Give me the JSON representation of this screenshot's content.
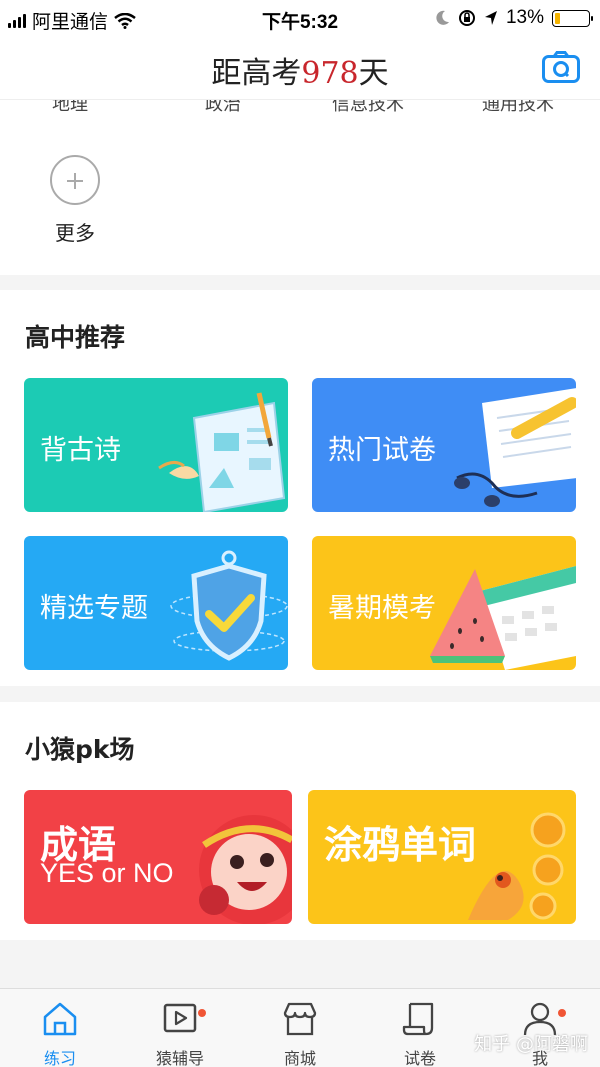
{
  "status_bar": {
    "carrier": "阿里通信",
    "time": "下午5:32",
    "battery": "13%",
    "battery_level": 0.13
  },
  "header": {
    "title_prefix": "距高考",
    "days": "978",
    "title_suffix": "天",
    "camera_icon": "camera-icon"
  },
  "top_grid": {
    "cut_labels": [
      "地理",
      "政治",
      "信息技术",
      "通用技术"
    ],
    "more_label": "更多"
  },
  "recommend": {
    "title": "高中推荐",
    "cards": [
      {
        "label": "背古诗",
        "color": "#1ccbb4"
      },
      {
        "label": "热门试卷",
        "color": "#3f8df5"
      },
      {
        "label": "精选专题",
        "color": "#25a9f4"
      },
      {
        "label": "暑期模考",
        "color": "#fcc419"
      }
    ]
  },
  "pk": {
    "title": "小猿pk场",
    "cards": [
      {
        "label": "成语",
        "sublabel": "YES or NO",
        "color": "#f24146"
      },
      {
        "label": "涂鸦单词",
        "color": "#fcc419"
      }
    ]
  },
  "tabbar": {
    "items": [
      {
        "label": "练习",
        "icon": "house-icon",
        "active": true
      },
      {
        "label": "猿辅导",
        "icon": "video-icon",
        "badge": true
      },
      {
        "label": "商城",
        "icon": "store-icon"
      },
      {
        "label": "试卷",
        "icon": "scroll-icon"
      },
      {
        "label": "我",
        "icon": "user-icon",
        "badge": true
      }
    ]
  },
  "watermark": "知乎 @阿磐啊"
}
